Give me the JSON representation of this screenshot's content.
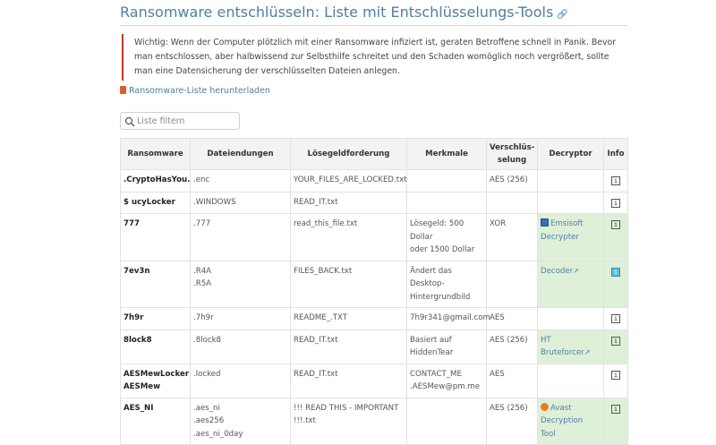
{
  "title": "Ransomware entschlüsseln: Liste mit Entschlüsselungs-Tools",
  "title_link_icon": "link-icon",
  "warning": "Wichtig: Wenn der Computer plötzlich mit einer Ransomware infiziert ist, geraten Betroffene schnell in Panik. Bevor man entschlossen, aber halbwissend zur Selbsthilfe schreitet und den Schaden womöglich noch vergrößert, sollte man eine Datensicherung der verschlüsselten Dateien anlegen.",
  "download_label": "Ransomware-Liste herunterladen",
  "search": {
    "placeholder": "Liste filtern",
    "value": ""
  },
  "colors": {
    "accent": "#4f7ea3",
    "warning_border": "#c0392b",
    "decryptor_bg": "#dff0d8"
  },
  "table": {
    "headers": {
      "ransomware": "Ransomware",
      "extensions": "Dateiendungen",
      "ransom_note": "Lösegeldforderung",
      "features": "Merkmale",
      "encryption_1": "Verschlüs-",
      "encryption_2": "selung",
      "decryptor": "Decryptor",
      "info": "Info"
    },
    "rows": [
      {
        "name": ".CryptoHasYou.",
        "ext1": ".enc",
        "ext2": "",
        "ext3": "",
        "note1": "YOUR_FILES_ARE_LOCKED.txt",
        "note2": "",
        "feat1": "",
        "feat2": "",
        "enc": "AES (256)",
        "dec1": "",
        "dec2": ""
      },
      {
        "name": "$ ucyLocker",
        "ext1": ".WINDOWS",
        "ext2": "",
        "ext3": "",
        "note1": "READ_IT.txt",
        "note2": "",
        "feat1": "",
        "feat2": "",
        "enc": "",
        "dec1": "",
        "dec2": ""
      },
      {
        "name": "777",
        "ext1": ".777",
        "ext2": "",
        "ext3": "",
        "note1": "read_this_file.txt",
        "note2": "",
        "feat1": "Lösegeld: 500 Dollar",
        "feat2": "oder 1500 Dollar",
        "enc": "XOR",
        "dec1": "Emsisoft",
        "dec2": "Decrypter"
      },
      {
        "name": "7ev3n",
        "ext1": ".R4A",
        "ext2": ".R5A",
        "ext3": "",
        "note1": "FILES_BACK.txt",
        "note2": "",
        "feat1": "Ändert das Desktop-",
        "feat2": "Hintergrundbild",
        "enc": "",
        "dec1": "Decoder",
        "dec2": ""
      },
      {
        "name": "7h9r",
        "ext1": ".7h9r",
        "ext2": "",
        "ext3": "",
        "note1": "README_.TXT",
        "note2": "",
        "feat1": "7h9r341@gmail.com",
        "feat2": "",
        "enc": "AES",
        "dec1": "",
        "dec2": ""
      },
      {
        "name": "8lock8",
        "ext1": ".8lock8",
        "ext2": "",
        "ext3": "",
        "note1": "READ_IT.txt",
        "note2": "",
        "feat1": "Basiert auf",
        "feat2": "HiddenTear",
        "enc": "AES (256)",
        "dec1": "HT",
        "dec2": "Bruteforcer"
      },
      {
        "name": "AESMewLocker",
        "name2": "AESMew",
        "ext1": ".locked",
        "ext2": "",
        "ext3": "",
        "note1": "READ_IT.txt",
        "note2": "",
        "feat1": "CONTACT_ME",
        "feat2": ".AESMew@pm.me",
        "enc": "AES",
        "dec1": "",
        "dec2": ""
      },
      {
        "name": "AES_NI",
        "ext1": ".aes_ni",
        "ext2": ".aes256",
        "ext3": ".aes_ni_0day",
        "note1": "!!! READ THIS - IMPORTANT",
        "note2": "!!!.txt",
        "feat1": "",
        "feat2": "",
        "enc": "AES (256)",
        "dec1": "Avast",
        "dec2": "Decryption",
        "dec3": "Tool"
      }
    ]
  }
}
